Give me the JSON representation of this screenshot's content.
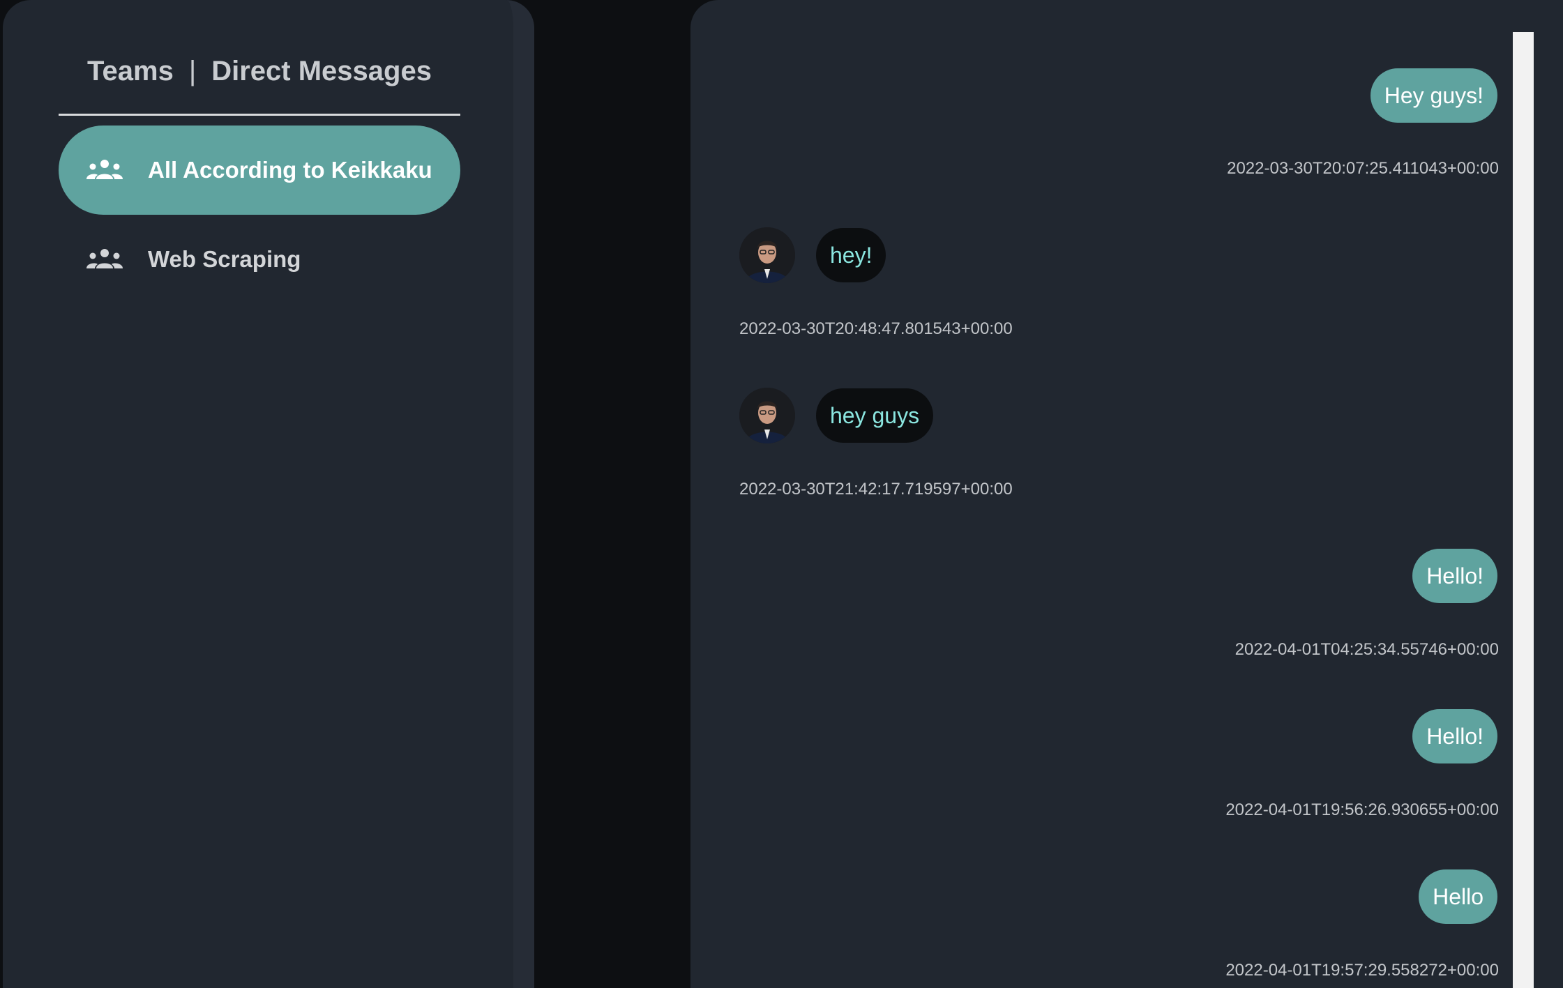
{
  "sidebar": {
    "tabs": {
      "teams": "Teams",
      "separator": "|",
      "direct_messages": "Direct Messages"
    },
    "teams": [
      {
        "label": "All According to Keikkaku",
        "icon": "group-icon",
        "active": true
      },
      {
        "label": "Web Scraping",
        "icon": "group-icon",
        "active": false
      }
    ]
  },
  "messages": [
    {
      "text": "Hey guys!",
      "timestamp": "2022-03-30T20:07:25.411043+00:00",
      "mine": true
    },
    {
      "text": "hey!",
      "timestamp": "2022-03-30T20:48:47.801543+00:00",
      "mine": false,
      "avatar": "user-avatar"
    },
    {
      "text": "hey guys",
      "timestamp": "2022-03-30T21:42:17.719597+00:00",
      "mine": false,
      "avatar": "user-avatar"
    },
    {
      "text": "Hello!",
      "timestamp": "2022-04-01T04:25:34.55746+00:00",
      "mine": true
    },
    {
      "text": "Hello!",
      "timestamp": "2022-04-01T19:56:26.930655+00:00",
      "mine": true
    },
    {
      "text": "Hello",
      "timestamp": "2022-04-01T19:57:29.558272+00:00",
      "mine": true
    }
  ],
  "colors": {
    "accent": "#5fa39f",
    "panel": "#212730",
    "background": "#0d0f12",
    "incoming_bubble": "#0c0e10",
    "incoming_text": "#8be6e0"
  }
}
